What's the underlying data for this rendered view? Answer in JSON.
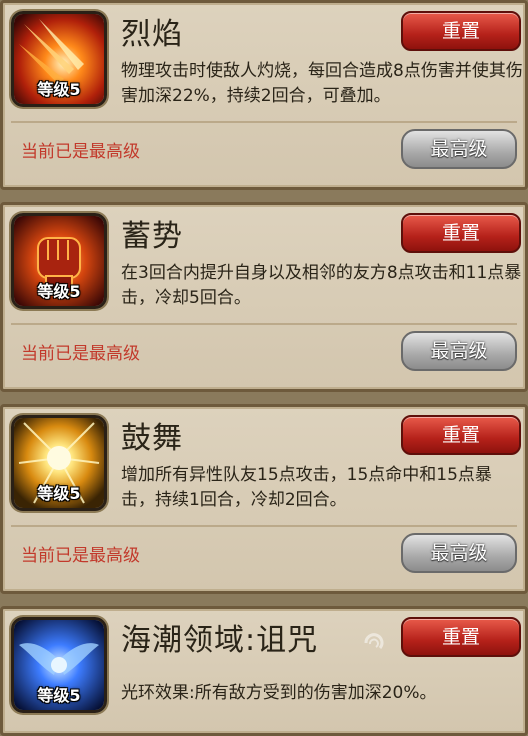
{
  "skills": [
    {
      "name": "烈焰",
      "level": "等级5",
      "desc": "物理攻击时使敌人灼烧，每回合造成8点伤害并使其伤害加深22%，持续2回合，可叠加。",
      "reset_label": "重置",
      "status": "当前已是最高级",
      "max_label": "最高级",
      "icon": "flame-slash-icon"
    },
    {
      "name": "蓄势",
      "level": "等级5",
      "desc": "在3回合内提升自身以及相邻的友方8点攻击和11点暴击，冷却5回合。",
      "reset_label": "重置",
      "status": "当前已是最高级",
      "max_label": "最高级",
      "icon": "fist-icon"
    },
    {
      "name": "鼓舞",
      "level": "等级5",
      "desc": "增加所有异性队友15点攻击，15点命中和15点暴击，持续1回合，冷却2回合。",
      "reset_label": "重置",
      "status": "当前已是最高级",
      "max_label": "最高级",
      "icon": "radiant-burst-icon"
    },
    {
      "name": "海潮领域:诅咒",
      "level": "等级5",
      "desc": "光环效果:所有敌方受到的伤害加深20%。",
      "reset_label": "重置",
      "icon": "blue-wings-icon"
    }
  ],
  "colors": {
    "card_bg": "#d8ccb4",
    "reset_button": "#c52a20",
    "status_text": "#c2392b",
    "max_button": "#a9a9a9"
  }
}
